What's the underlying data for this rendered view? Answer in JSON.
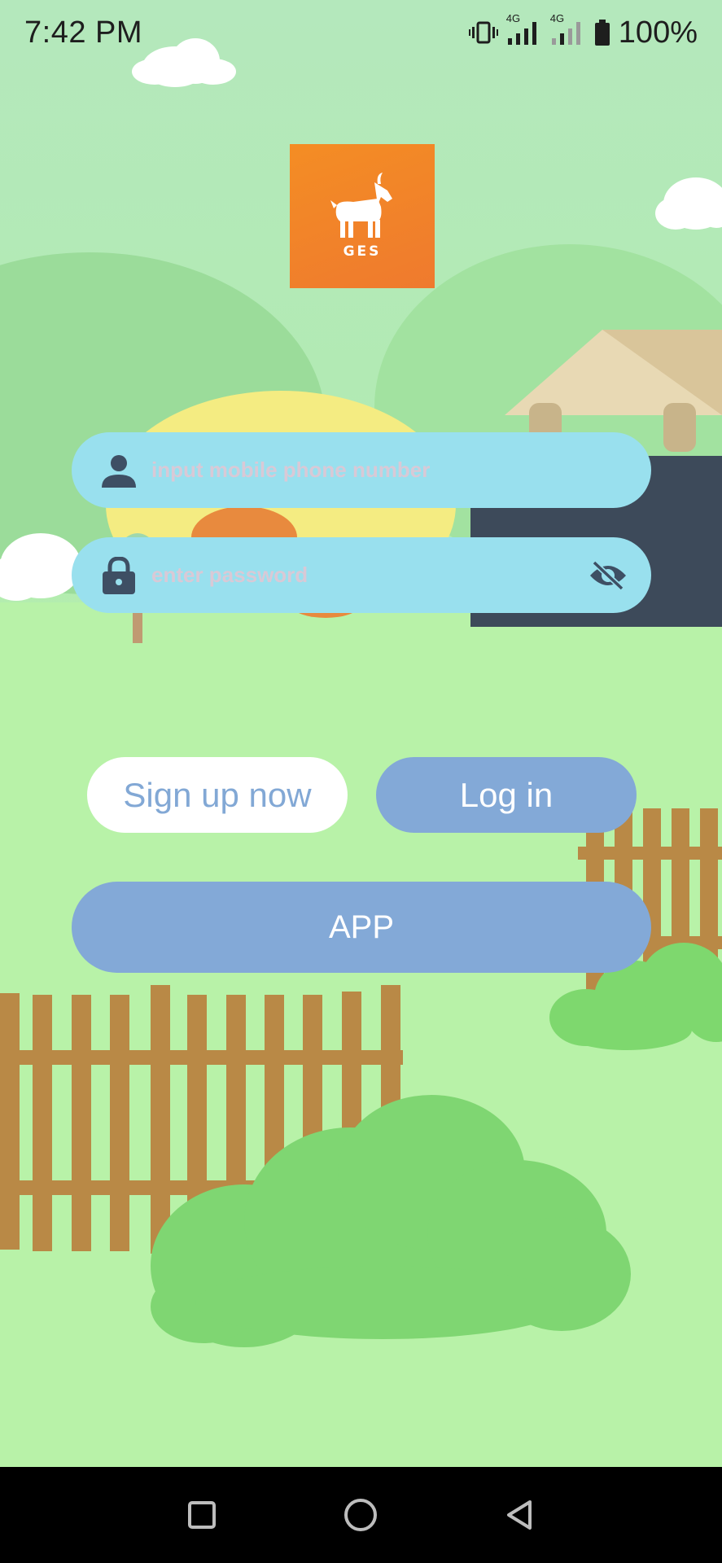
{
  "status_bar": {
    "time": "7:42 PM",
    "network_1": "4G",
    "network_2": "4G",
    "battery": "100%",
    "icons": [
      "vibrate-icon",
      "signal-icon",
      "signal-icon",
      "battery-icon"
    ]
  },
  "logo": {
    "text": "GES",
    "icon": "goat-icon",
    "color": "#f48d24"
  },
  "form": {
    "phone_placeholder": "input mobile phone number",
    "password_placeholder": "enter password",
    "phone_icon": "user-icon",
    "password_icon": "lock-icon",
    "visibility_icon": "eye-off-icon"
  },
  "buttons": {
    "signup": "Sign up now",
    "login": "Log in",
    "app": "APP"
  },
  "nav": {
    "items": [
      "recents-icon",
      "home-icon",
      "back-icon"
    ]
  },
  "colors": {
    "input_bg": "#99e0ee",
    "button_blue": "#83a9d7",
    "signup_text": "#82a8d5",
    "logo_orange": "#f48d24"
  }
}
